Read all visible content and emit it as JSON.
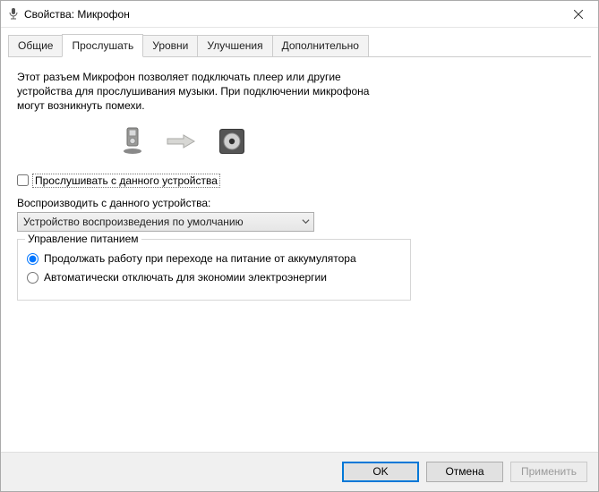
{
  "window": {
    "title": "Свойства: Микрофон"
  },
  "tabs": [
    {
      "label": "Общие"
    },
    {
      "label": "Прослушать"
    },
    {
      "label": "Уровни"
    },
    {
      "label": "Улучшения"
    },
    {
      "label": "Дополнительно"
    }
  ],
  "active_tab_index": 1,
  "listen": {
    "description": "Этот разъем Микрофон позволяет подключать плеер или другие устройства для прослушивания музыки. При подключении микрофона могут возникнуть помехи.",
    "checkbox_label": "Прослушивать с данного устройства",
    "checkbox_checked": false,
    "playback_label": "Воспроизводить с данного устройства:",
    "selected_device": "Устройство воспроизведения по умолчанию",
    "power_group": "Управление питанием",
    "power_options": [
      "Продолжать работу при переходе на питание от аккумулятора",
      "Автоматически отключать для экономии электроэнергии"
    ],
    "power_selected_index": 0
  },
  "buttons": {
    "ok": "OK",
    "cancel": "Отмена",
    "apply": "Применить"
  },
  "icons": {
    "title_icon": "microphone-icon",
    "close": "close-icon",
    "source": "player-device-icon",
    "arrow": "arrow-right-icon",
    "dest": "speaker-device-icon",
    "dropdown": "chevron-down-icon"
  }
}
